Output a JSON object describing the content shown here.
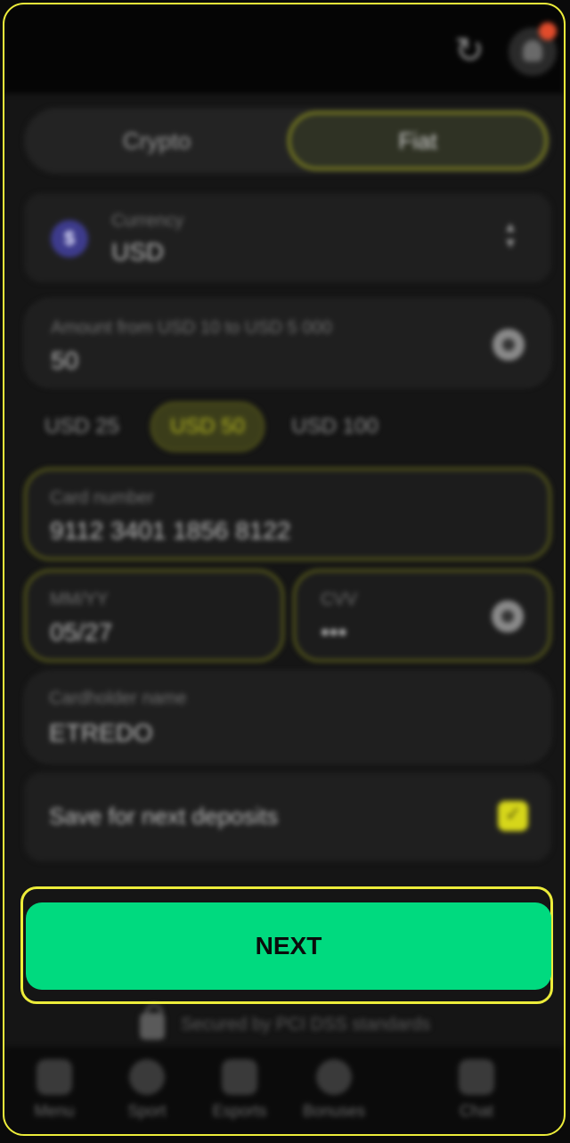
{
  "tabs": {
    "crypto": "Crypto",
    "fiat": "Fiat"
  },
  "currency": {
    "icon": "dollar-coin-icon",
    "symbol": "$",
    "label": "Currency",
    "value": "USD"
  },
  "amount": {
    "label": "Amount from USD 10 to USD 5 000",
    "value": "50"
  },
  "quick_amounts": [
    "USD 25",
    "USD 50",
    "USD 100"
  ],
  "card": {
    "number_label": "Card number",
    "number_value": "9112 3401 1856 8122",
    "expiry_label": "MM/YY",
    "expiry_value": "05/27",
    "cvv_label": "CVV",
    "cvv_value": "•••",
    "holder_label": "Cardholder name",
    "holder_value": "ETREDO"
  },
  "save_option": {
    "label": "Save for next deposits",
    "checked": true
  },
  "next_button": "NEXT",
  "secured_text": "Secured by PCI DSS standards",
  "bottom_nav": [
    "Menu",
    "Sport",
    "Esports",
    "Bonuses",
    "Chat"
  ],
  "colors": {
    "accent_green": "#00da7f",
    "highlight_yellow": "#ecec3a",
    "background": "#151515"
  }
}
